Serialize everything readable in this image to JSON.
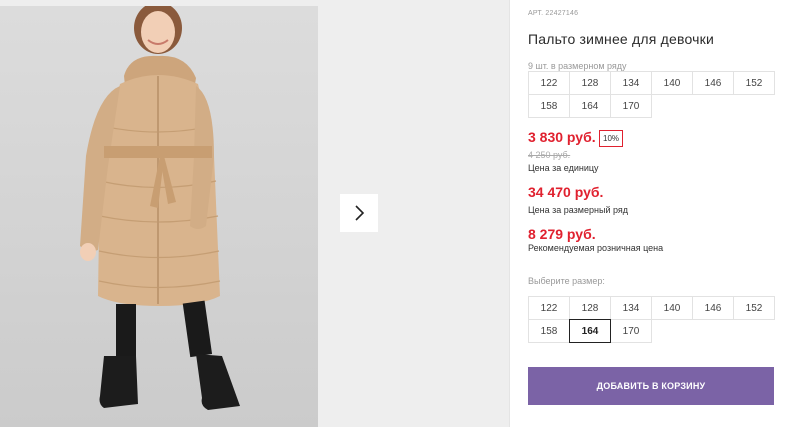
{
  "gallery": {
    "photo_alt": "girl-in-beige-winter-coat"
  },
  "product": {
    "sku": "АРТ. 22427146",
    "title": "Пальто зимнее для девочки",
    "pack_label": "9 шт. в размерном ряду",
    "pack_sizes": [
      "122",
      "128",
      "134",
      "140",
      "146",
      "152",
      "158",
      "164",
      "170"
    ],
    "unit_price": "3 830 руб.",
    "discount": "10%",
    "old_price": "4 250 руб.",
    "unit_price_note": "Цена за единицу",
    "pack_price": "34 470 руб.",
    "pack_price_note": "Цена за размерный ряд",
    "retail_price": "8 279 руб.",
    "retail_price_note": "Рекомендуемая розничная цена",
    "choose_label": "Выберите размер:",
    "sizes": [
      "122",
      "128",
      "134",
      "140",
      "146",
      "152",
      "158",
      "164",
      "170"
    ],
    "selected_size": "164",
    "add_to_cart": "ДОБАВИТЬ В КОРЗИНУ"
  },
  "colors": {
    "accent": "#7b63a6",
    "price": "#e0212f",
    "coat": "#d9b48d"
  }
}
